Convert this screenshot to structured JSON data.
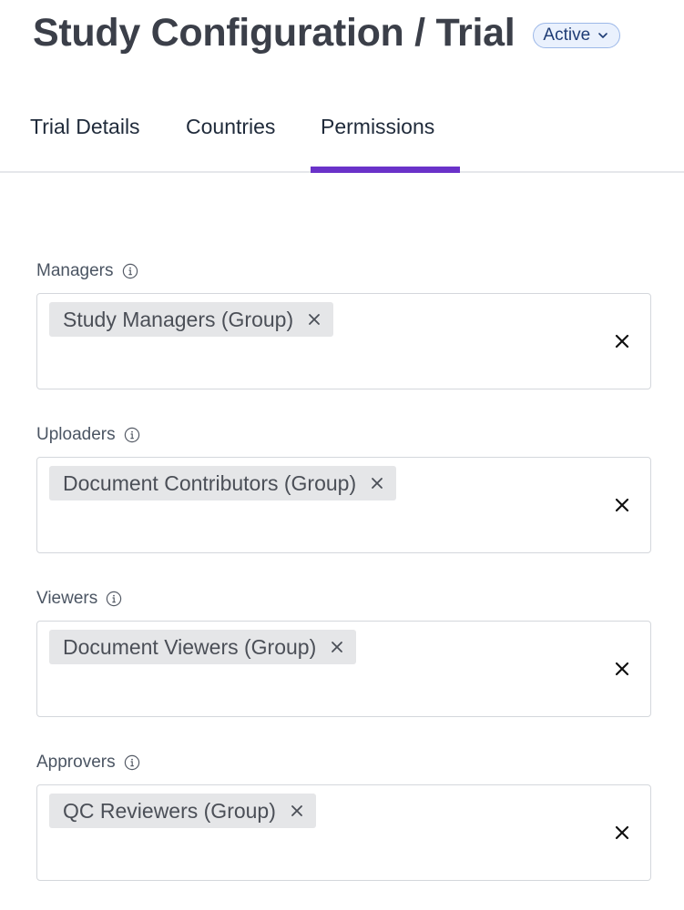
{
  "header": {
    "title": "Study Configuration / Trial",
    "status": "Active"
  },
  "tabs": [
    {
      "label": "Trial Details",
      "active": false
    },
    {
      "label": "Countries",
      "active": false
    },
    {
      "label": "Permissions",
      "active": true
    }
  ],
  "fields": [
    {
      "label": "Managers",
      "chips": [
        "Study Managers (Group)"
      ]
    },
    {
      "label": "Uploaders",
      "chips": [
        "Document Contributors (Group)"
      ]
    },
    {
      "label": "Viewers",
      "chips": [
        "Document Viewers (Group)"
      ]
    },
    {
      "label": "Approvers",
      "chips": [
        "QC Reviewers (Group)"
      ]
    }
  ],
  "colors": {
    "accent": "#6a32c9",
    "status_bg": "#eaf1fd",
    "status_border": "#9cb8e8",
    "chip_bg": "#e5e6e8"
  },
  "icons": {
    "status_dropdown": "chevron-down-icon",
    "field_info": "info-icon",
    "chip_remove": "close-icon",
    "field_clear": "close-icon"
  }
}
